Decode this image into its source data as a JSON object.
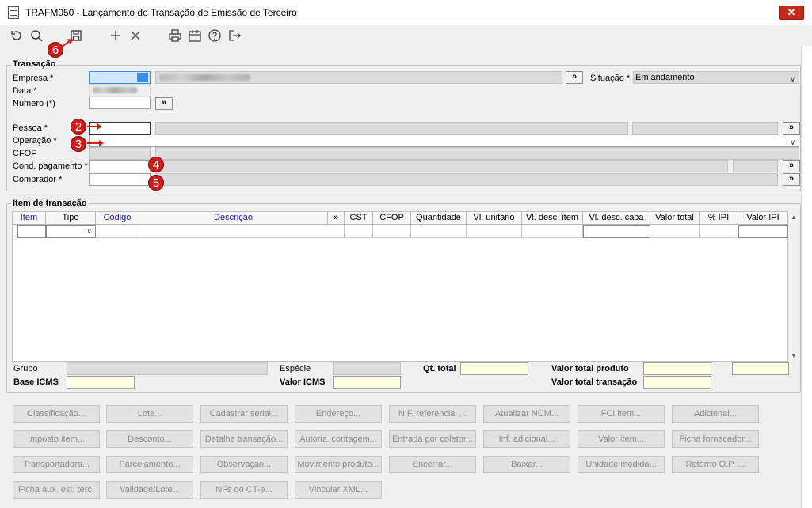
{
  "window": {
    "title": "TRAFM050 - Lançamento de Transação de Emissão de Terceiro",
    "close_label": "✕"
  },
  "toolbar": {
    "icons": [
      "undo-icon",
      "search-icon",
      "save-icon",
      "add-icon",
      "delete-icon",
      "print-icon",
      "calendar-icon",
      "help-icon",
      "exit-icon"
    ]
  },
  "badges": {
    "b2": "2",
    "b3": "3",
    "b4": "4",
    "b5": "5",
    "b6": "6"
  },
  "transacao": {
    "legend": "Transação",
    "empresa_label": "Empresa *",
    "data_label": "Data *",
    "numero_label": "Número (*)",
    "pessoa_label": "Pessoa *",
    "operacao_label": "Operação *",
    "cfop_label": "CFOP",
    "cond_pagamento_label": "Cond. pagamento *",
    "comprador_label": "Comprador *",
    "situacao_label": "Situação *",
    "situacao_value": "Em andamento",
    "lookup_label": "»"
  },
  "item": {
    "legend": "Item de transação",
    "columns": [
      "Item",
      "Tipo",
      "Código",
      "Descrição",
      "»",
      "CST",
      "CFOP",
      "Quantidade",
      "Vl. unitário",
      "Vl. desc. item",
      "Vl. desc. capa",
      "Valor total",
      "% IPI",
      "Valor IPI"
    ]
  },
  "totals": {
    "grupo": "Grupo",
    "especie": "Espécie",
    "qt_total": "Qt. total",
    "valor_total_produto": "Valor total produto",
    "base_icms": "Base ICMS",
    "valor_icms": "Valor ICMS",
    "valor_total_transacao": "Valor total transação"
  },
  "buttons": [
    [
      "Classificação...",
      "Lote...",
      "Cadastrar serial...",
      "Endereço...",
      "N.F. referencial ...",
      "Atualizar NCM...",
      "FCI item...",
      "Adicional..."
    ],
    [
      "Imposto item...",
      "Desconto...",
      "Detalhe transação...",
      "Autoriz. contagem...",
      "Entrada por coletor...",
      "Inf. adicional...",
      "Valor item...",
      "Ficha fornecedor..."
    ],
    [
      "Transportadora...",
      "Parcelamento...",
      "Observação...",
      "Movimento produto...",
      "Encerrar...",
      "Baixar...",
      "Unidade medida...",
      "Retorno O.P. ..."
    ],
    [
      "Ficha aux. est. terc.",
      "Validade/Lote...",
      "NFs do CT-e...",
      "Vincular XML..."
    ]
  ],
  "colors": {
    "badge": "#d11a1a",
    "yellow_field": "#ffffe1",
    "readonly_field": "#dcdcdc",
    "focus_field": "#cfe8ff"
  }
}
